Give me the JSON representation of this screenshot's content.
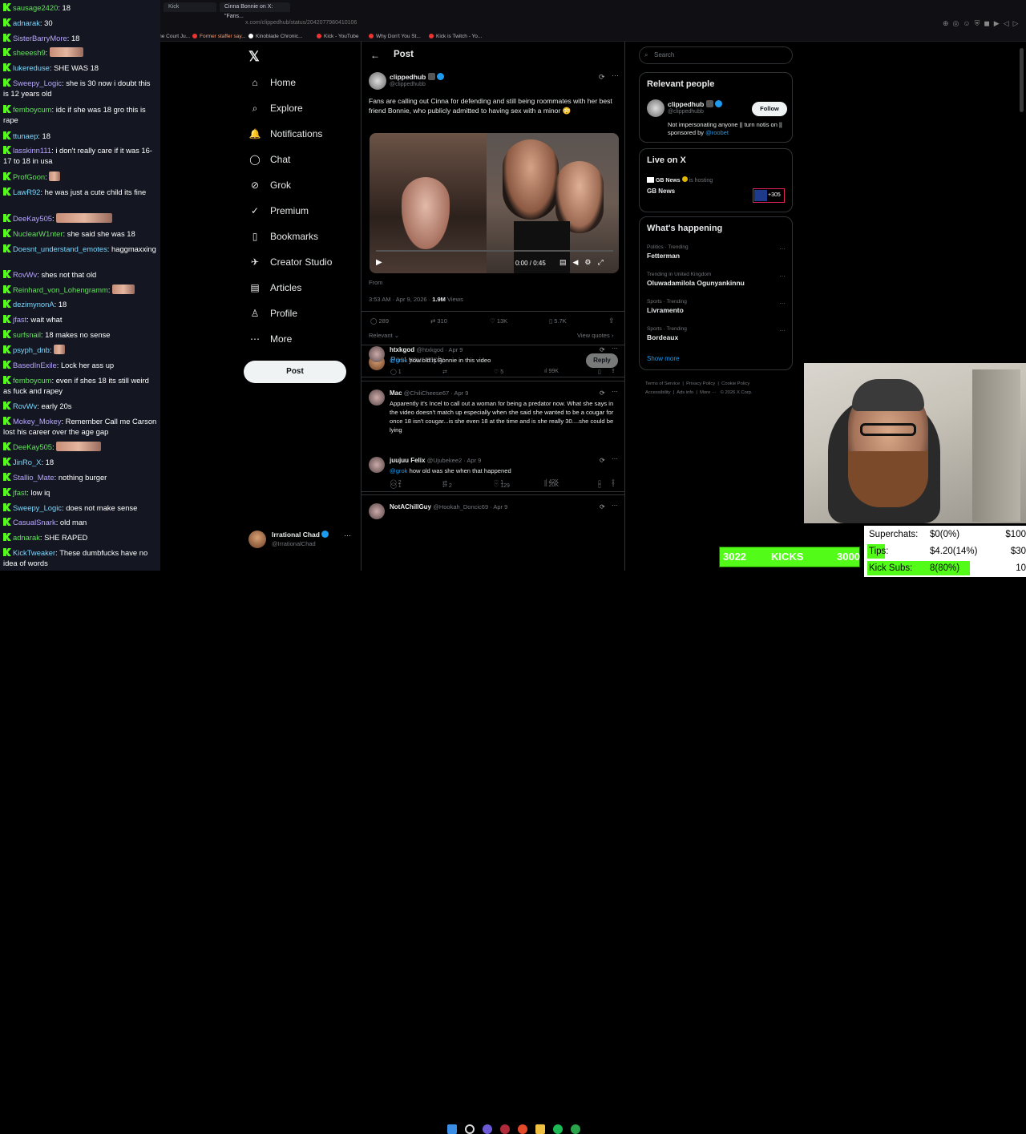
{
  "browser": {
    "tabs": [
      "Kick",
      "Cinna Bonnie on X: \"Fans..."
    ],
    "url": "x.com/clippedhub/status/2042077980410106",
    "bookmarks": [
      "Supreme Court Ju...",
      "Former staffer say...",
      "Kinoblade Chronic...",
      "Kick - YouTube",
      "Why Don't You St...",
      "Kick is Twitch - Yo..."
    ]
  },
  "chat": [
    {
      "user": "sausage2420",
      "text": "18"
    },
    {
      "user": "adnarak",
      "text": "30"
    },
    {
      "user": "SisterBarryMore",
      "text": "18"
    },
    {
      "user": "sheeesh9",
      "text": "",
      "emote": 3
    },
    {
      "user": "lukereduse",
      "text": "SHE WAS 18"
    },
    {
      "user": "Sweepy_Logic",
      "text": "she is 30 now i doubt this is 12 years old"
    },
    {
      "user": "femboycum",
      "text": "idc if she was 18 gro this is rape"
    },
    {
      "user": "ttunaep",
      "text": "18"
    },
    {
      "user": "lasskinn111",
      "text": "i don't really care if it was 16-17 to 18 in usa"
    },
    {
      "user": "ProfGoon",
      "text": "",
      "emote": 1
    },
    {
      "user": "LawR92",
      "text": "he was just a cute child its fine"
    },
    {
      "user": "DeeKay505",
      "text": "",
      "emote": 5
    },
    {
      "user": "NuclearW1nter",
      "text": "she said she was 18"
    },
    {
      "user": "Doesnt_understand_emotes",
      "text": "haggmaxxing"
    },
    {
      "user": "RovWv",
      "text": "shes not that old"
    },
    {
      "user": "Reinhard_von_Lohengramm",
      "text": "",
      "emote": 2
    },
    {
      "user": "dezimynonA",
      "text": "18"
    },
    {
      "user": "jfast",
      "text": "wait what"
    },
    {
      "user": "surfsnail",
      "text": "18 makes no sense"
    },
    {
      "user": "psyph_dnb",
      "text": "",
      "emote": 1
    },
    {
      "user": "BasedInExile",
      "text": "Lock her ass up"
    },
    {
      "user": "femboycum",
      "text": "even if shes 18 its still weird as fuck and rapey"
    },
    {
      "user": "RovWv",
      "text": "early 20s"
    },
    {
      "user": "Mokey_Mokey",
      "text": "Remember Call me Carson lost his career over the age gap"
    },
    {
      "user": "DeeKay505",
      "text": "",
      "emote": 4
    },
    {
      "user": "JinRo_X",
      "text": "18"
    },
    {
      "user": "Stallio_Mate",
      "text": "nothing burger"
    },
    {
      "user": "jfast",
      "text": "low iq"
    },
    {
      "user": "Sweepy_Logic",
      "text": "does not make sense"
    },
    {
      "user": "CasualSnark",
      "text": "old man"
    },
    {
      "user": "adnarak",
      "text": "SHE RAPED"
    },
    {
      "user": "KickTweaker",
      "text": "These dumbfucks have no idea of words"
    }
  ],
  "x": {
    "nav": [
      "Home",
      "Explore",
      "Notifications",
      "Chat",
      "Grok",
      "Premium",
      "Bookmarks",
      "Creator Studio",
      "Articles",
      "Profile",
      "More"
    ],
    "post_button": "Post",
    "account": {
      "name": "Irrational Chad",
      "handle": "@IrrationalChad"
    },
    "header": "Post",
    "post": {
      "author": "clippedhub",
      "handle": "@clippedhubb",
      "text": "Fans are calling out Cinna for defending and still being roommates with her best friend Bonnie, who publicly admitted to having sex with a minor 😳",
      "video_time": "0:00 / 0:45",
      "from": "From",
      "timestamp": "3:53 AM · Apr 9, 2026 ·",
      "views": "1.9M",
      "views_label": "Views",
      "replies": "289",
      "reposts": "310",
      "likes": "13K",
      "bookmarks": "5.7K",
      "relevant": "Relevant",
      "view_quotes": "View quotes"
    },
    "reply_placeholder": "Post your reply",
    "reply_button": "Reply",
    "replies": [
      {
        "name": "htxkgod",
        "handle": "@htxkgod · Apr 9",
        "text": "how old is Bonnie in this video",
        "mention": "@grok",
        "r": "1",
        "rt": "",
        "l": "5",
        "v": "99K"
      },
      {
        "name": "Mac",
        "handle": "@ChiliCheese67 · Apr 9",
        "text": "Apparently it's Incel to call out a woman for being a predator now. What she says in the video doesn't match up especially when she said she wanted to be a cougar for once 18 isn't cougar...is she even 18 at the time and is she really 30....she could be lying",
        "mention": "",
        "r": "1",
        "rt": "2",
        "l": "129",
        "v": "20K"
      },
      {
        "name": "juujuu Felix",
        "handle": "@Ujubekee2 · Apr 9",
        "text": "how old was she when that happened",
        "mention": "@grok",
        "r": "2",
        "rt": "",
        "l": "1",
        "v": "42K"
      },
      {
        "name": "NotAChillGuy",
        "handle": "@Hookah_Doncic69 · Apr 9",
        "text": "",
        "mention": "",
        "r": "",
        "rt": "",
        "l": "",
        "v": ""
      }
    ],
    "search_placeholder": "Search",
    "relevant_people": {
      "title": "Relevant people",
      "name": "clippedhub",
      "handle": "@clippedhubb",
      "bio": "Not impersonating anyone || turn notis on || sponsored by",
      "sponsor": "@roobet",
      "follow": "Follow"
    },
    "live": {
      "title": "Live on X",
      "host": "GB News",
      "hosting": "is hosting",
      "show": "GB News",
      "count": "+305"
    },
    "trending": {
      "title": "What's happening",
      "items": [
        {
          "context": "Politics · Trending",
          "topic": "Fetterman"
        },
        {
          "context": "Trending in United Kingdom",
          "topic": "Oluwadamilola Ogunyankinnu"
        },
        {
          "context": "Sports · Trending",
          "topic": "Livramento"
        },
        {
          "context": "Sports · Trending",
          "topic": "Bordeaux"
        }
      ],
      "show_more": "Show more"
    },
    "footer": [
      "Terms of Service",
      "Privacy Policy",
      "Cookie Policy",
      "Accessibility",
      "Ads info",
      "More ···",
      "© 2026 X Corp."
    ]
  },
  "overlay": {
    "kick_count": "3022",
    "kick_label": "KICKS",
    "kick_goal": "3000",
    "goals": [
      {
        "label": "Superchats:",
        "value": "$0(0%)",
        "target": "$100",
        "fraction": 0,
        "color": "#ffffff"
      },
      {
        "label": "Tips:",
        "value": "$4.20(14%)",
        "target": "$30",
        "fraction": 0.14,
        "color": "#53fc18"
      },
      {
        "label": "Kick Subs:",
        "value": "8(80%)",
        "target": "10",
        "fraction": 0.8,
        "color": "#53fc18"
      }
    ]
  },
  "colors": {
    "kick_green": "#53fc18",
    "x_blue": "#1d9bf0",
    "chat_bg": "#141722"
  }
}
